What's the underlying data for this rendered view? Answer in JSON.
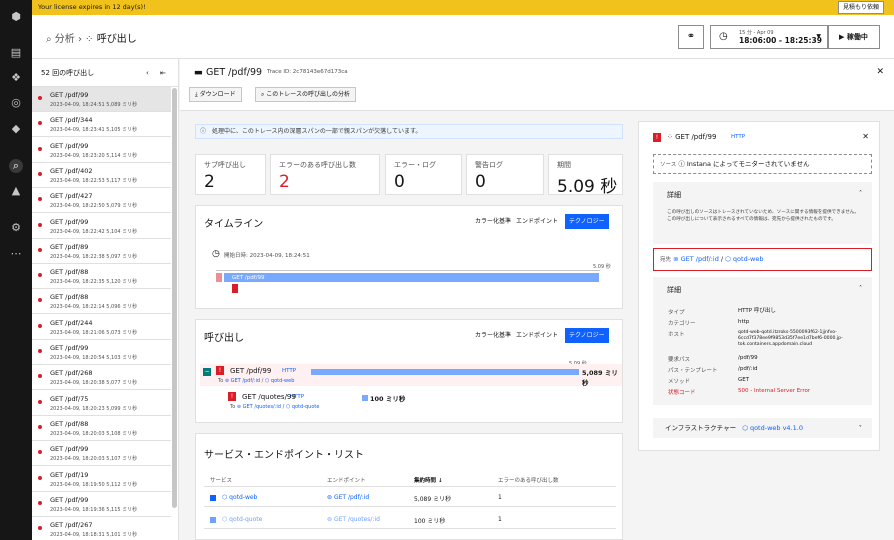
{
  "banner": {
    "text": "Your license expires in 12 day(s)!",
    "quote_button": "見積もり依頼"
  },
  "header": {
    "breadcrumb_root": "分析",
    "breadcrumb_current": "呼び出し",
    "time_small": "15 分 - Apr 09",
    "time_range": "18:06:00 - 18:25:39",
    "play_button": "稼働中"
  },
  "call_list": {
    "title": "52 回の呼び出し",
    "items": [
      {
        "name": "GET /pdf/99",
        "meta": "2023-04-09, 18:24:51  5,089 ミリ秒"
      },
      {
        "name": "GET /pdf/344",
        "meta": "2023-04-09, 18:23:41  5,105 ミリ秒"
      },
      {
        "name": "GET /pdf/99",
        "meta": "2023-04-09, 18:23:20  5,114 ミリ秒"
      },
      {
        "name": "GET /pdf/402",
        "meta": "2023-04-09, 18:22:53  5,117 ミリ秒"
      },
      {
        "name": "GET /pdf/427",
        "meta": "2023-04-09, 18:22:50  5,079 ミリ秒"
      },
      {
        "name": "GET /pdf/99",
        "meta": "2023-04-09, 18:22:42  5,104 ミリ秒"
      },
      {
        "name": "GET /pdf/89",
        "meta": "2023-04-09, 18:22:38  5,097 ミリ秒"
      },
      {
        "name": "GET /pdf/88",
        "meta": "2023-04-09, 18:22:35  5,120 ミリ秒"
      },
      {
        "name": "GET /pdf/88",
        "meta": "2023-04-09, 18:22:14  5,096 ミリ秒"
      },
      {
        "name": "GET /pdf/244",
        "meta": "2023-04-09, 18:21:06  5,073 ミリ秒"
      },
      {
        "name": "GET /pdf/99",
        "meta": "2023-04-09, 18:20:54  5,103 ミリ秒"
      },
      {
        "name": "GET /pdf/268",
        "meta": "2023-04-09, 18:20:38  5,077 ミリ秒"
      },
      {
        "name": "GET /pdf/75",
        "meta": "2023-04-09, 18:20:23  5,099 ミリ秒"
      },
      {
        "name": "GET /pdf/88",
        "meta": "2023-04-09, 18:20:03  5,108 ミリ秒"
      },
      {
        "name": "GET /pdf/99",
        "meta": "2023-04-09, 18:20:03  5,107 ミリ秒"
      },
      {
        "name": "GET /pdf/19",
        "meta": "2023-04-09, 18:19:50  5,112 ミリ秒"
      },
      {
        "name": "GET /pdf/99",
        "meta": "2023-04-09, 18:19:36  5,115 ミリ秒"
      },
      {
        "name": "GET /pdf/267",
        "meta": "2023-04-09, 18:18:31  5,101 ミリ秒"
      }
    ]
  },
  "detail": {
    "title": "GET /pdf/99",
    "trace_id": "Trace ID: 2c78143e67d173ca",
    "download_button": "ダウンロード",
    "analyze_button": "このトレースの呼び出しの分析",
    "notice": "処理中に、このトレース内の深層スパンの一部で親スパンが欠落しています。",
    "stats": [
      {
        "label": "サブ呼び出し",
        "value": "2"
      },
      {
        "label": "エラーのある呼び出し数",
        "value": "2"
      },
      {
        "label": "エラー・ログ",
        "value": "0"
      },
      {
        "label": "警告ログ",
        "value": "0"
      },
      {
        "label": "期間",
        "value": "5.09 秒"
      }
    ],
    "timeline": {
      "title": "タイムライン",
      "tabs": [
        "カラー化基準",
        "エンドポイント",
        "テクノロジー"
      ],
      "start_label": "開始日時: 2023-04-09, 18:24:51",
      "end_label": "5.09 秒",
      "bar_label": "GET /pdf/99"
    },
    "calls": {
      "title": "呼び出し",
      "tabs": [
        "カラー化基準",
        "エンドポイント",
        "テクノロジー"
      ],
      "scale_label": "5.09 秒",
      "rows": [
        {
          "name": "GET /pdf/99",
          "tech": "HTTP",
          "duration": "5,089 ミリ秒",
          "to_prefix": "To",
          "endpoint": "GET /pdf/:id",
          "service": "qotd-web"
        },
        {
          "name": "GET /quotes/99",
          "tech": "HTTP",
          "duration": "100 ミリ秒",
          "to_prefix": "To",
          "endpoint": "GET /quotes/:id",
          "service": "qotd-quote"
        }
      ]
    },
    "services": {
      "title": "サービス・エンドポイント・リスト",
      "columns": [
        "サービス",
        "エンドポイント",
        "集約時間",
        "エラーのある呼び出し数"
      ],
      "rows": [
        {
          "service": "qotd-web",
          "endpoint": "GET /pdf/:id",
          "time": "5,089 ミリ秒",
          "errors": "1"
        },
        {
          "service": "qotd-quote",
          "endpoint": "GET /quotes/:id",
          "time": "100 ミリ秒",
          "errors": "1"
        }
      ]
    }
  },
  "side_panel": {
    "title": "GET /pdf/99",
    "tech": "HTTP",
    "source_prefix": "ソース",
    "source_text": "Instana によってモニターされていません",
    "details_title": "詳細",
    "details_text": "この呼び出しのソースはトレースされていないため、ソースに関する情報を提供できません。この呼び出しについて表示されるすべての情報は、宛先から提供されたものです。",
    "dest_prefix": "宛先",
    "dest_endpoint": "GET /pdf/:id",
    "dest_service": "qotd-web",
    "details2_title": "詳細",
    "kv": [
      {
        "k": "タイプ",
        "v": "HTTP 呼び出し"
      },
      {
        "k": "カテゴリー",
        "v": "http"
      },
      {
        "k": "ホスト",
        "v": "qotd-web-qotd.itzroks-5500093f62-1jjnfvo-6ccd7f378ee9f9853d35f7ee1d7bef6-0000.jp-tok.containers.appdomain.cloud"
      },
      {
        "k": "要求パス",
        "v": "/pdf/99"
      },
      {
        "k": "パス・テンプレート",
        "v": "/pdf/:id"
      },
      {
        "k": "メソッド",
        "v": "GET"
      },
      {
        "k": "状態コード",
        "v": "500 - Internal Server Error"
      }
    ],
    "infra_label": "インフラストラクチャー",
    "infra_value": "qotd-web v4.1.0"
  },
  "colors": {
    "accent": "#0f62fe",
    "error": "#da1e28",
    "banner": "#f1c21b",
    "bar": "#78a9ff"
  }
}
